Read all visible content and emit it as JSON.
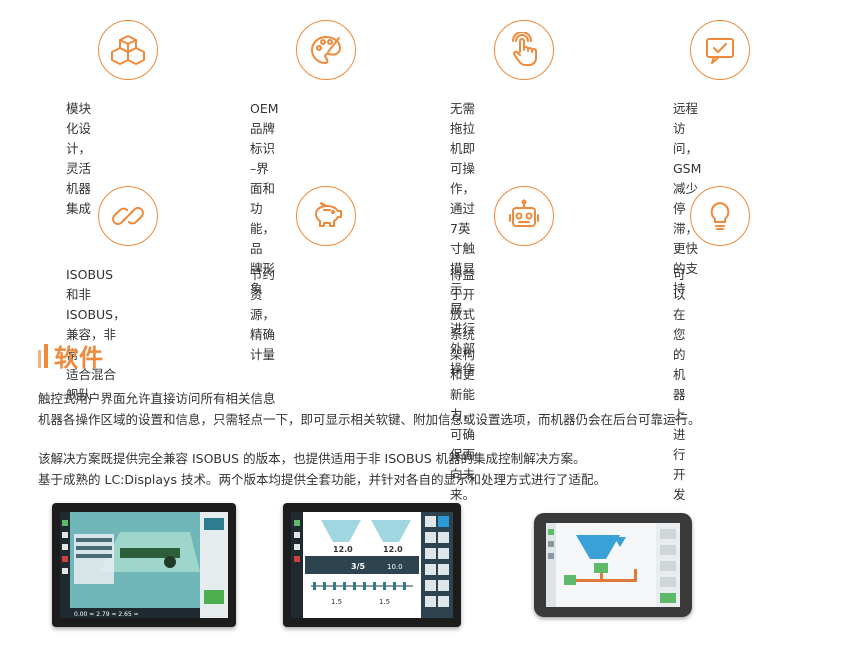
{
  "features": [
    {
      "icon": "blocks-icon",
      "text": "模块化设计，灵活机器集成"
    },
    {
      "icon": "palette-icon",
      "text": "OEM品牌标识 –界面和功能，品\n牌形象"
    },
    {
      "icon": "touch-hand-icon",
      "text": "无需拖拉机即可操作，通过7英寸触\n摸显示屏，进行外部操作"
    },
    {
      "icon": "chat-check-icon",
      "text": "远程访问，GSM减少\n停滞，更快的支持"
    },
    {
      "icon": "link-icon",
      "text": "ISOBUS 和非 ISOBUS，兼容，非常\n适合混合舰队"
    },
    {
      "icon": "piggy-bank-icon",
      "text": "节约资源，精确计量"
    },
    {
      "icon": "robot-icon",
      "text": "得益于开放式系统架构和更新能力，\n可确保面向未来。"
    },
    {
      "icon": "lightbulb-icon",
      "text": "可以在您的机器上进\n行开发"
    }
  ],
  "section": {
    "title": "软件",
    "paragraph1": [
      "触控式用户界面允许直接访问所有相关信息",
      "机器各操作区域的设置和信息，只需轻点一下，即可显示相关软键、附加信息或设置选项，而机器仍会在后台可靠运行。"
    ],
    "paragraph2": [
      "该解决方案既提供完全兼容 ISOBUS 的版本，也提供适用于非 ISOBUS 机器的集成控制解决方案。",
      "基于成熟的 LC:Displays 技术。两个版本均提供全套功能，并针对各自的显示和处理方式进行了适配。"
    ]
  },
  "screens": {
    "device1": {
      "readout": "0.00 ≈ 2.79 ≈ 2.65 ="
    },
    "device2": {
      "value1": "12.0",
      "value2": "12.0",
      "value3": "3/5",
      "value4": "10.0",
      "value5": "1.5",
      "value6": "1.5"
    }
  },
  "colors": {
    "accent": "#ef8a3c",
    "accent_light": "#f4b585",
    "text": "#333333"
  }
}
